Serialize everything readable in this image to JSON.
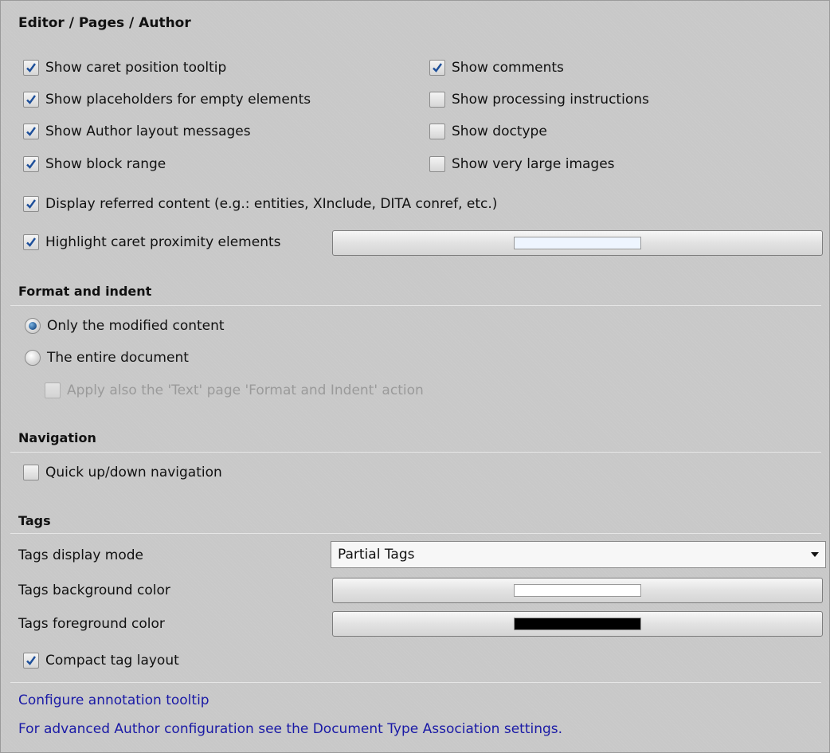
{
  "title": "Editor / Pages / Author",
  "options_left": [
    {
      "label": "Show caret position tooltip",
      "checked": true
    },
    {
      "label": "Show placeholders for empty elements",
      "checked": true
    },
    {
      "label": "Show Author layout messages",
      "checked": true
    },
    {
      "label": "Show block range",
      "checked": true
    }
  ],
  "options_right": [
    {
      "label": "Show comments",
      "checked": true
    },
    {
      "label": "Show processing instructions",
      "checked": false
    },
    {
      "label": "Show doctype",
      "checked": false
    },
    {
      "label": "Show very large images",
      "checked": false
    }
  ],
  "display_referred": {
    "label": "Display referred content (e.g.: entities, XInclude, DITA conref, etc.)",
    "checked": true
  },
  "highlight_caret": {
    "label": "Highlight caret proximity elements",
    "checked": true,
    "color": "#eef5ff"
  },
  "format_indent": {
    "title": "Format and indent",
    "option_modified": {
      "label": "Only the modified content",
      "selected": true
    },
    "option_entire": {
      "label": "The entire document",
      "selected": false
    },
    "apply_text": {
      "label": "Apply also the 'Text' page 'Format and Indent' action",
      "checked": false,
      "enabled": false
    }
  },
  "navigation": {
    "title": "Navigation",
    "quick_updown": {
      "label": "Quick up/down navigation",
      "checked": false
    }
  },
  "tags": {
    "title": "Tags",
    "display_mode_label": "Tags display mode",
    "display_mode_value": "Partial Tags",
    "bg_label": "Tags background color",
    "bg_color": "#ffffff",
    "fg_label": "Tags foreground color",
    "fg_color": "#000000",
    "compact": {
      "label": "Compact tag layout",
      "checked": true
    }
  },
  "links": {
    "annotation": "Configure annotation tooltip",
    "advanced": "For advanced Author configuration see the Document Type Association settings."
  }
}
